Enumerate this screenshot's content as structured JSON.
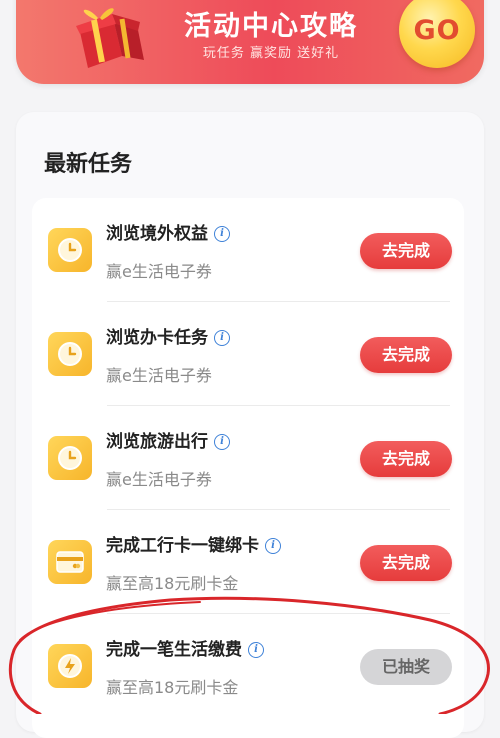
{
  "banner": {
    "title": "活动中心攻略",
    "subtitle": "玩任务 赢奖励 送好礼",
    "go_label": "GO"
  },
  "section_title": "最新任务",
  "tasks": [
    {
      "title": "浏览境外权益",
      "subtitle": "赢e生活电子券",
      "action": "去完成",
      "status": "todo",
      "icon": "clock-icon"
    },
    {
      "title": "浏览办卡任务",
      "subtitle": "赢e生活电子券",
      "action": "去完成",
      "status": "todo",
      "icon": "clock-icon"
    },
    {
      "title": "浏览旅游出行",
      "subtitle": "赢e生活电子券",
      "action": "去完成",
      "status": "todo",
      "icon": "clock-icon"
    },
    {
      "title": "完成工行卡一键绑卡",
      "subtitle": "赢至高18元刷卡金",
      "action": "去完成",
      "status": "todo",
      "icon": "card-icon"
    },
    {
      "title": "完成一笔生活缴费",
      "subtitle": "赢至高18元刷卡金",
      "action": "已抽奖",
      "status": "done",
      "icon": "payment-icon"
    }
  ],
  "colors": {
    "accent_red": "#e63c3c",
    "icon_yellow": "#f7b52b",
    "info_blue": "#3f82d8",
    "annotation_red": "#d9262a"
  }
}
